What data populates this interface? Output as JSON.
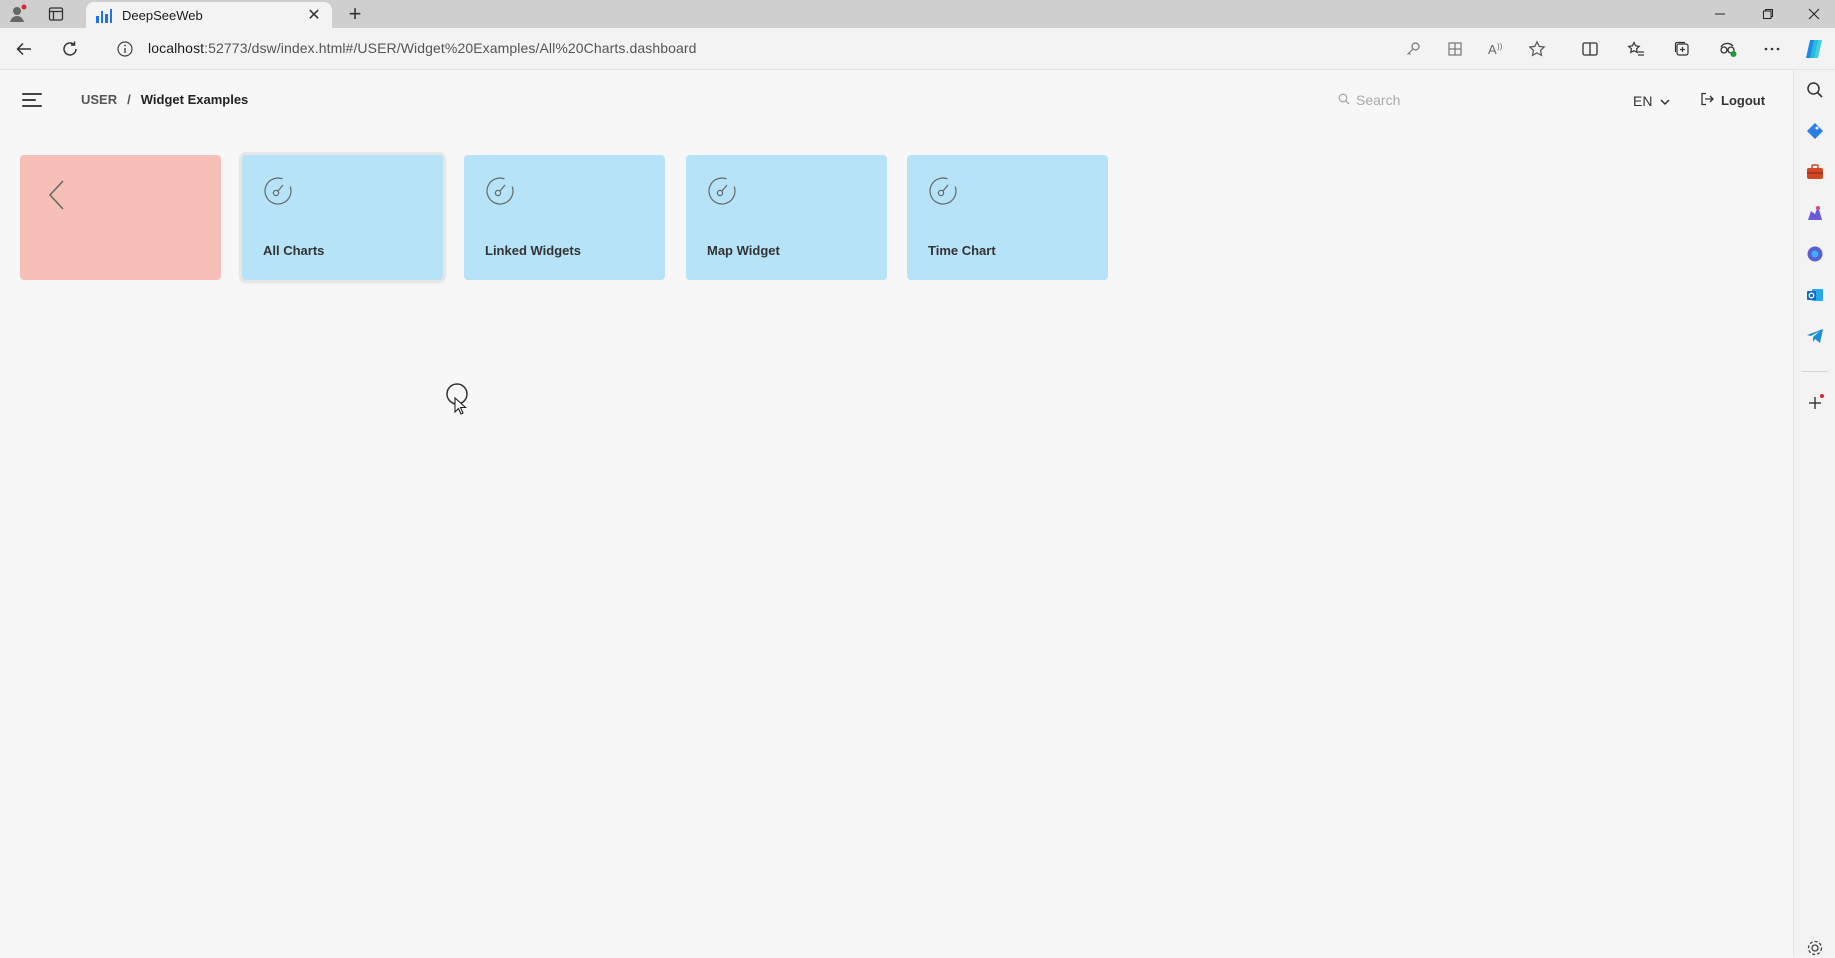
{
  "browser": {
    "tab_title": "DeepSeeWeb",
    "url_host": "localhost",
    "url_rest": ":52773/dsw/index.html#/USER/Widget%20Examples/All%20Charts.dashboard",
    "icons": [
      "profile-icon",
      "tab-actions-icon",
      "close-tab-icon",
      "new-tab-icon",
      "minimize-icon",
      "restore-icon",
      "close-window-icon",
      "back-icon",
      "refresh-icon",
      "site-info-icon",
      "key-icon",
      "app-available-icon",
      "read-aloud-icon",
      "favorite-icon",
      "split-screen-icon",
      "favorites-icon",
      "collections-icon",
      "extensions-icon",
      "more-icon",
      "copilot-icon"
    ]
  },
  "edge_sidebar": {
    "icons": [
      "search-icon",
      "shopping-icon",
      "tools-icon",
      "games-icon",
      "microsoft365-icon",
      "outlook-icon",
      "telegram-icon",
      "add-icon",
      "settings-icon"
    ]
  },
  "app": {
    "breadcrumb": {
      "root": "USER",
      "separator": "/",
      "current": "Widget Examples"
    },
    "search_placeholder": "Search",
    "language": "EN",
    "logout_label": "Logout",
    "tiles": [
      {
        "label": "",
        "type": "back",
        "color": "#f6bfb8"
      },
      {
        "label": "All Charts",
        "type": "dashboard",
        "color": "#b7e3f8",
        "selected": true
      },
      {
        "label": "Linked Widgets",
        "type": "dashboard",
        "color": "#b7e3f8"
      },
      {
        "label": "Map Widget",
        "type": "dashboard",
        "color": "#b7e3f8"
      },
      {
        "label": "Time Chart",
        "type": "dashboard",
        "color": "#b7e3f8"
      }
    ]
  }
}
